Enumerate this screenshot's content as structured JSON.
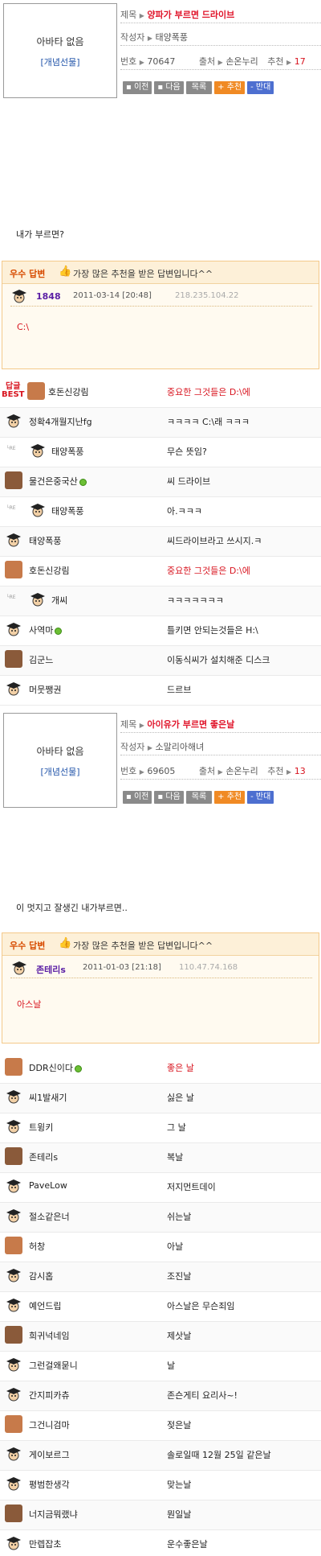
{
  "posts": [
    {
      "avatar_none": "아바타 없음",
      "gift_link": "[개념선물]",
      "title_label": "제목",
      "title": "양파가 부르면 드라이브",
      "author_label": "작성자",
      "author": "태양폭풍",
      "num_label": "번호",
      "num": "70647",
      "source_label": "출처",
      "source": "손온누리",
      "recommend_label": "추천",
      "recommend": "17",
      "buttons": {
        "prev": "이전",
        "next": "다음",
        "list": "목록",
        "rec": "추천",
        "opp": "반대"
      },
      "body": "내가 부르면?",
      "best": {
        "tag": "우수 답변",
        "msg": "가장 많은 추천을 받은 답변입니다^^",
        "nick": "1848",
        "date": "2011-03-14 [20:48]",
        "ip": "218.235.104.22",
        "answer": "C:\\"
      },
      "comments": [
        {
          "name": "호돈신강림",
          "text": "중요한 그것들은 D:\\에",
          "red": true,
          "best": true
        },
        {
          "name": "정확4개월지난fg",
          "text": "ㅋㅋㅋㅋ C:\\래 ㅋㅋㅋ"
        },
        {
          "name": "태양폭풍",
          "text": "무슨 뜻임?",
          "re": true
        },
        {
          "name": "물건은중국산",
          "text": "씨 드라이브",
          "online": true
        },
        {
          "name": "태양폭풍",
          "text": "아.ㅋㅋㅋ",
          "re": true
        },
        {
          "name": "태양폭풍",
          "text": "씨드라이브라고 쓰시지.ㅋ"
        },
        {
          "name": "호돈신강림",
          "text": "중요한 그것들은 D:\\에",
          "red": true
        },
        {
          "name": "개씨",
          "text": "ㅋㅋㅋㅋㅋㅋㅋ",
          "re": true
        },
        {
          "name": "사역마",
          "text": "틀키면 안되는것들은 H:\\",
          "online": true
        },
        {
          "name": "김군느",
          "text": "이동식씨가 설치해준 디스크"
        },
        {
          "name": "머뭇쨍권",
          "text": "드르브"
        }
      ]
    },
    {
      "avatar_none": "아바타 없음",
      "gift_link": "[개념선물]",
      "title_label": "제목",
      "title": "아이유가 부르면 좋은날",
      "author_label": "작성자",
      "author": "소말리아해녀",
      "num_label": "번호",
      "num": "69605",
      "source_label": "출처",
      "source": "손온누리",
      "recommend_label": "추천",
      "recommend": "13",
      "buttons": {
        "prev": "이전",
        "next": "다음",
        "list": "목록",
        "rec": "추천",
        "opp": "반대"
      },
      "body": "이 멋지고 잘생긴 내가부르면..",
      "best": {
        "tag": "우수 답변",
        "msg": "가장 많은 추천을 받은 답변입니다^^",
        "nick": "존테리s",
        "date": "2011-01-03 [21:18]",
        "ip": "110.47.74.168",
        "answer": "아스날"
      },
      "comments": [
        {
          "name": "DDR신이다",
          "text": "좋은 날",
          "red": true,
          "online": true
        },
        {
          "name": "씨1발새기",
          "text": "싫은 날"
        },
        {
          "name": "트윙키",
          "text": "그 날"
        },
        {
          "name": "존테리s",
          "text": "복날"
        },
        {
          "name": "PaveLow",
          "text": "저지먼트데이"
        },
        {
          "name": "절소같은너",
          "text": "쉬는날"
        },
        {
          "name": "허창",
          "text": "아날"
        },
        {
          "name": "감시홉",
          "text": "조진날"
        },
        {
          "name": "예언드립",
          "text": "아스날은 무슨죄임"
        },
        {
          "name": "희귀넉네임",
          "text": "제삿날"
        },
        {
          "name": "그런걸왜묻니",
          "text": "날"
        },
        {
          "name": "간지피카츄",
          "text": "존슨게티 요리사~!"
        },
        {
          "name": "그건니검마",
          "text": "젖은날"
        },
        {
          "name": "게이보르그",
          "text": "솔로일때 12월 25일 같은날"
        },
        {
          "name": "평범한생각",
          "text": "맞는날"
        },
        {
          "name": "너지금뭐랬냐",
          "text": "뭔일날"
        },
        {
          "name": "만렙잡초",
          "text": "운수좋은날"
        }
      ]
    }
  ]
}
